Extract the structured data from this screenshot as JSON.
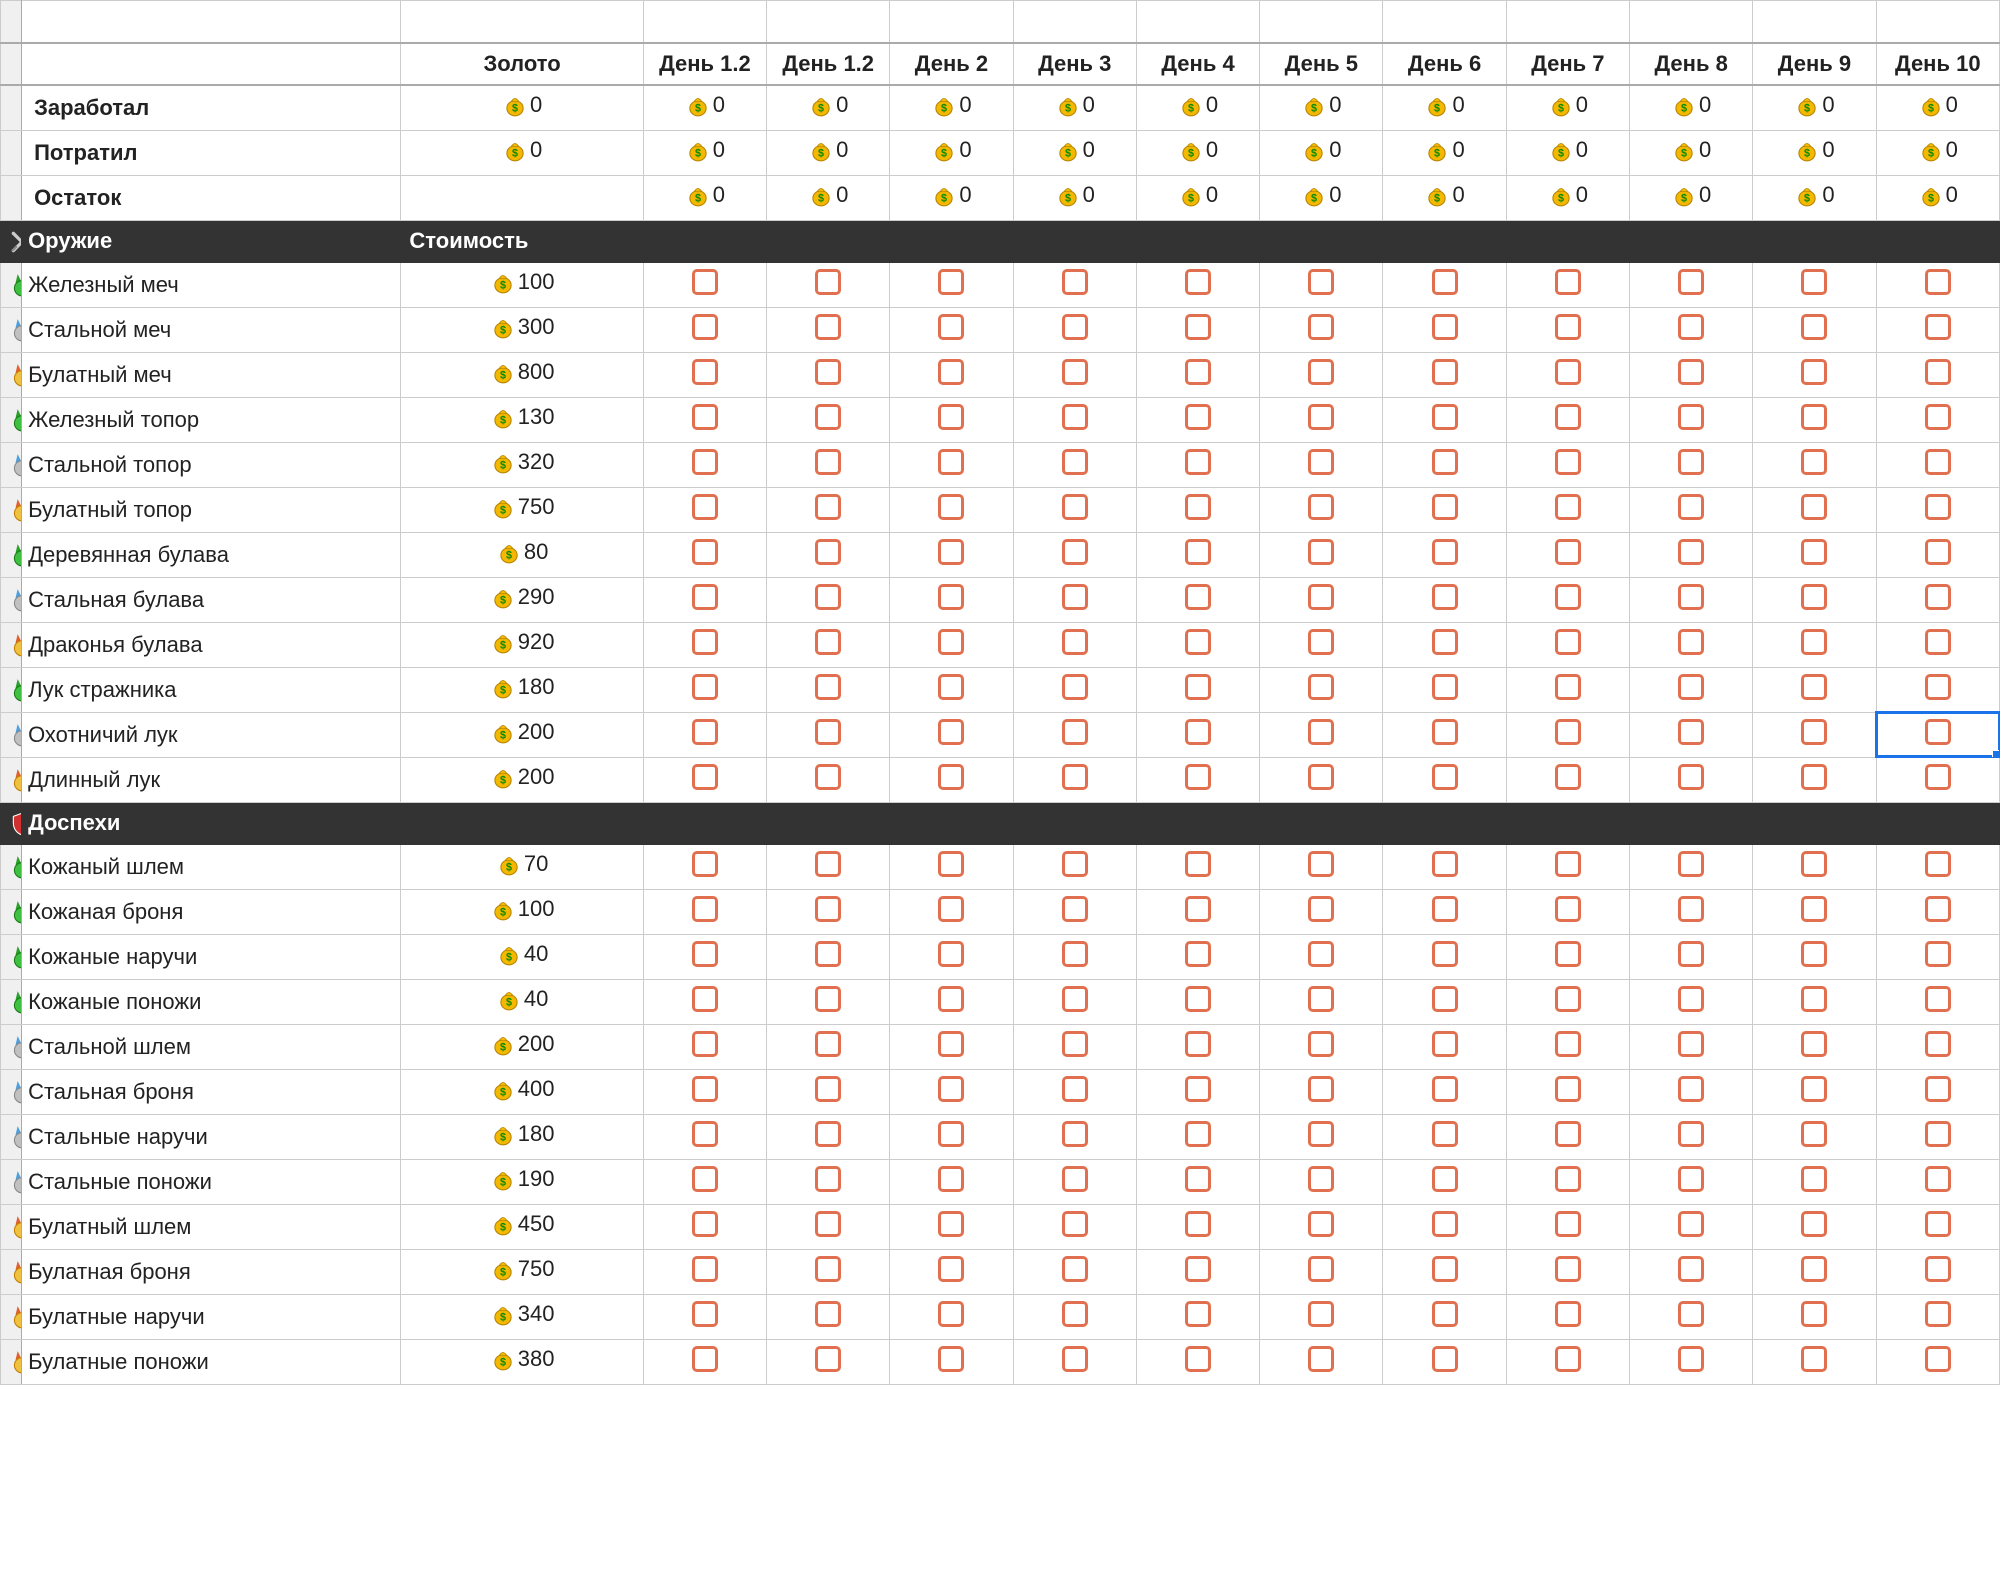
{
  "header": {
    "gold_col": "Золото",
    "days": [
      "День 1.2",
      "День 1.2",
      "День 2",
      "День 3",
      "День 4",
      "День 5",
      "День 6",
      "День 7",
      "День 8",
      "День 9",
      "День 10"
    ]
  },
  "summary": [
    {
      "label": "Заработал",
      "gold": "0",
      "days": [
        "0",
        "0",
        "0",
        "0",
        "0",
        "0",
        "0",
        "0",
        "0",
        "0",
        "0"
      ]
    },
    {
      "label": "Потратил",
      "gold": "0",
      "days": [
        "0",
        "0",
        "0",
        "0",
        "0",
        "0",
        "0",
        "0",
        "0",
        "0",
        "0"
      ]
    },
    {
      "label": "Остаток",
      "gold": "",
      "days": [
        "0",
        "0",
        "0",
        "0",
        "0",
        "0",
        "0",
        "0",
        "0",
        "0",
        "0"
      ]
    }
  ],
  "sections": [
    {
      "icon": "swords",
      "title": "Оружие",
      "cost_header": "Стоимость",
      "items": [
        {
          "tier": "green",
          "name": "Железный меч",
          "cost": "100"
        },
        {
          "tier": "silver",
          "name": "Стальной меч",
          "cost": "300"
        },
        {
          "tier": "gold",
          "name": "Булатный меч",
          "cost": "800"
        },
        {
          "tier": "green",
          "name": "Железный топор",
          "cost": "130"
        },
        {
          "tier": "silver",
          "name": "Стальной топор",
          "cost": "320"
        },
        {
          "tier": "gold",
          "name": "Булатный топор",
          "cost": "750"
        },
        {
          "tier": "green",
          "name": "Деревянная булава",
          "cost": "80"
        },
        {
          "tier": "silver",
          "name": "Стальная булава",
          "cost": "290"
        },
        {
          "tier": "gold",
          "name": "Драконья булава",
          "cost": "920"
        },
        {
          "tier": "green",
          "name": "Лук стражника",
          "cost": "180"
        },
        {
          "tier": "silver",
          "name": "Охотничий лук",
          "cost": "200"
        },
        {
          "tier": "gold",
          "name": "Длинный лук",
          "cost": "200"
        }
      ]
    },
    {
      "icon": "shield",
      "title": "Доспехи",
      "cost_header": "",
      "items": [
        {
          "tier": "green",
          "name": "Кожаный шлем",
          "cost": "70"
        },
        {
          "tier": "green",
          "name": "Кожаная броня",
          "cost": "100"
        },
        {
          "tier": "green",
          "name": "Кожаные наручи",
          "cost": "40"
        },
        {
          "tier": "green",
          "name": "Кожаные поножи",
          "cost": "40"
        },
        {
          "tier": "silver",
          "name": "Стальной шлем",
          "cost": "200"
        },
        {
          "tier": "silver",
          "name": "Стальная броня",
          "cost": "400"
        },
        {
          "tier": "silver",
          "name": "Стальные наручи",
          "cost": "180"
        },
        {
          "tier": "silver",
          "name": "Стальные поножи",
          "cost": "190"
        },
        {
          "tier": "gold",
          "name": "Булатный шлем",
          "cost": "450"
        },
        {
          "tier": "gold",
          "name": "Булатная броня",
          "cost": "750"
        },
        {
          "tier": "gold",
          "name": "Булатные наручи",
          "cost": "340"
        },
        {
          "tier": "gold",
          "name": "Булатные поножи",
          "cost": "380"
        }
      ]
    }
  ],
  "selected_cell": {
    "section": 0,
    "item_index": 10,
    "day_col": 10
  }
}
